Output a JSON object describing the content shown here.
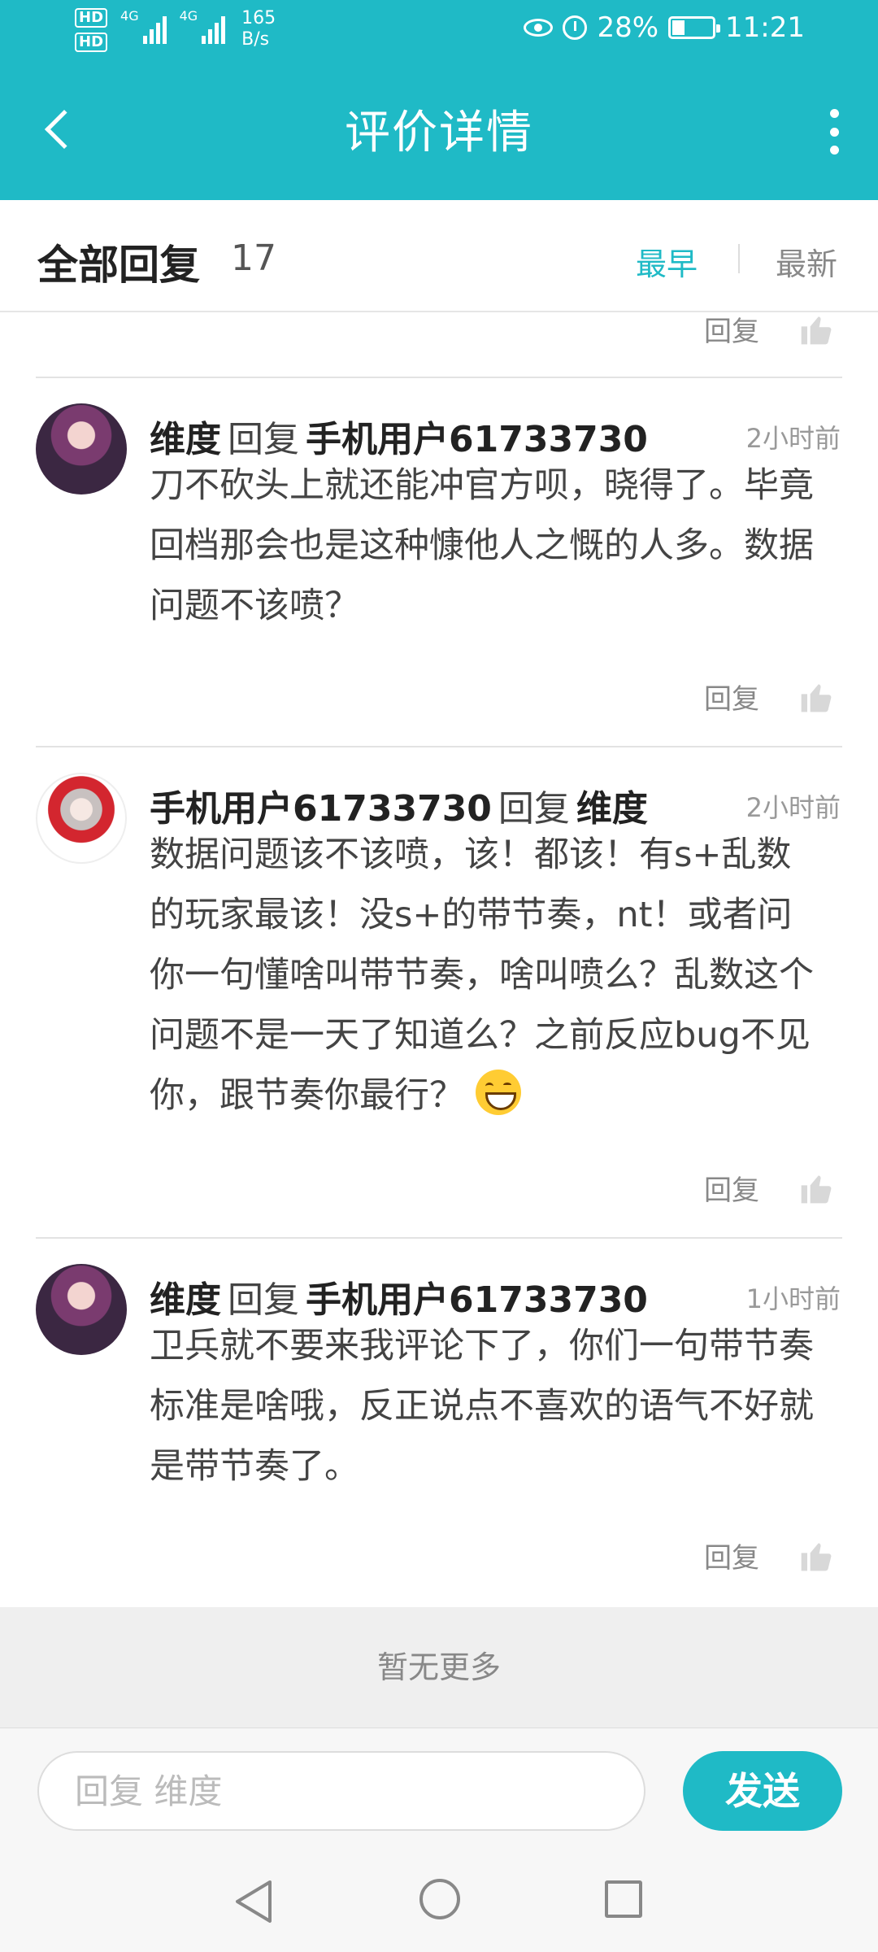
{
  "status_bar": {
    "hd1": "HD",
    "hd2": "HD",
    "net1": "4G",
    "net2": "4G",
    "speed_value": "165",
    "speed_unit": "B/s",
    "battery": "28%",
    "time": "11:21"
  },
  "header": {
    "title": "评价详情"
  },
  "filter": {
    "label": "全部回复",
    "count": "17",
    "earliest": "最早",
    "latest": "最新"
  },
  "reply_label": "回复",
  "comments": [
    {
      "user": "维度",
      "reply_word": "回复",
      "target": "手机用户61733730",
      "time": "2小时前",
      "text": "刀不砍头上就还能冲官方呗，晓得了。毕竟回档那会也是这种慷他人之慨的人多。数据问题不该喷？"
    },
    {
      "user": "手机用户61733730",
      "reply_word": "回复",
      "target": "维度",
      "time": "2小时前",
      "text": "数据问题该不该喷，该！都该！有s+乱数的玩家最该！没s+的带节奏，nt！或者问你一句懂啥叫带节奏，啥叫喷么？乱数这个问题不是一天了知道么？之前反应bug不见你，跟节奏你最行？"
    },
    {
      "user": "维度",
      "reply_word": "回复",
      "target": "手机用户61733730",
      "time": "1小时前",
      "text": "卫兵就不要来我评论下了，你们一句带节奏标准是啥哦，反正说点不喜欢的语气不好就是带节奏了。"
    }
  ],
  "no_more": "暂无更多",
  "input": {
    "placeholder": "回复 维度",
    "send_label": "发送"
  },
  "colors": {
    "accent": "#1fbac6"
  }
}
